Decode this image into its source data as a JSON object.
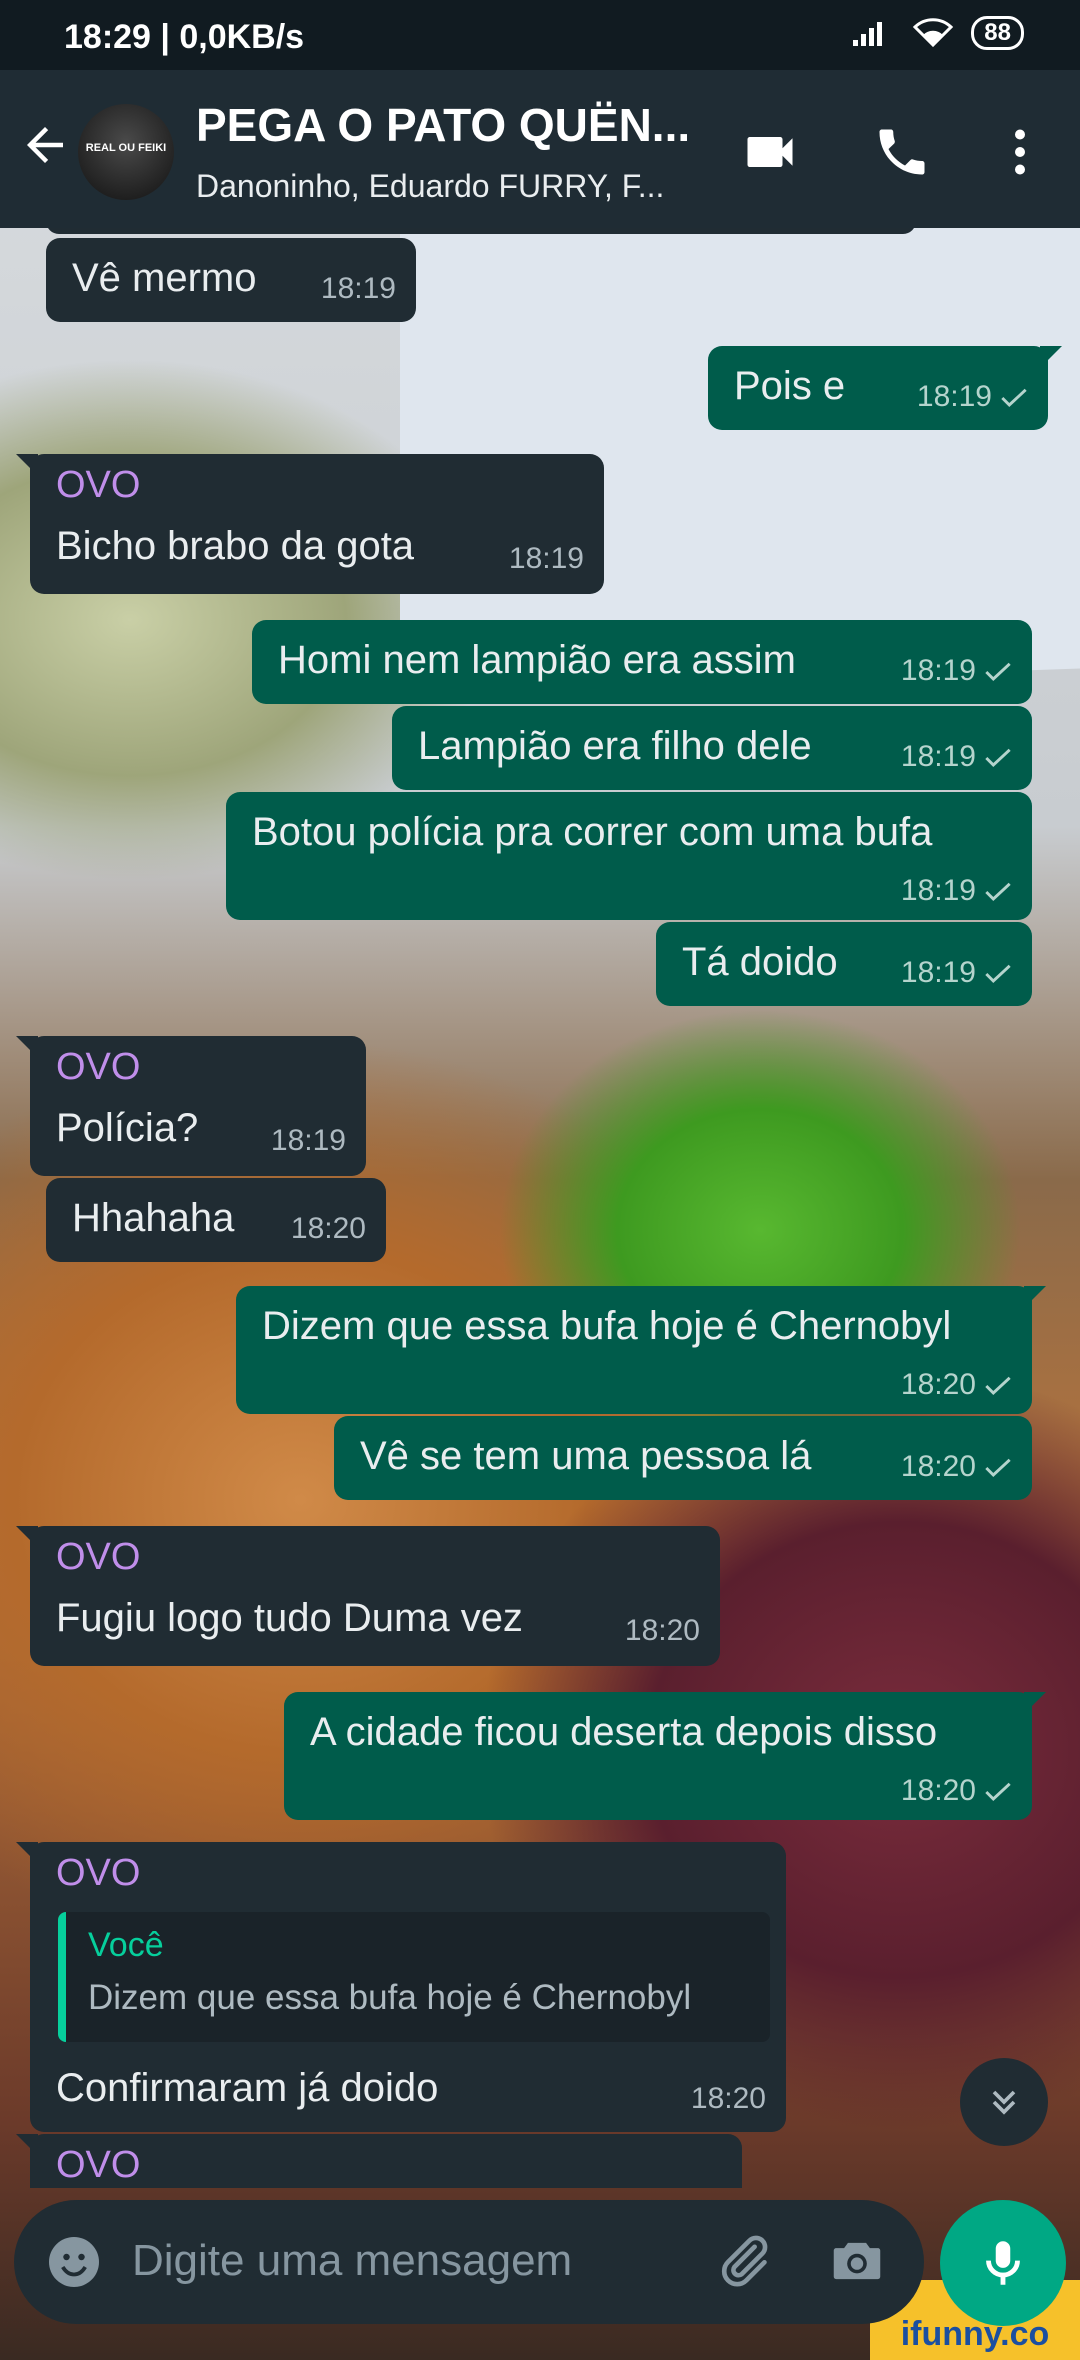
{
  "status_bar": {
    "time": "18:29 | 0,0KB/s",
    "battery": "88"
  },
  "header": {
    "back_icon": "arrow-left-icon",
    "avatar_text": "REAL OU FEIKI",
    "title": "PEGA O PATO QUËN...",
    "subtitle": "Danoninho, Eduardo FURRY, F...",
    "icons": [
      "video-call-icon",
      "phone-icon",
      "more-vert-icon"
    ]
  },
  "messages": [
    {
      "dir": "in",
      "text": "Vê mermo",
      "time": "18:19"
    },
    {
      "dir": "out",
      "text": "Pois e",
      "time": "18:19"
    },
    {
      "dir": "in",
      "sender": "OVO",
      "text": "Bicho brabo da gota",
      "time": "18:19"
    },
    {
      "dir": "out",
      "text": "Homi nem lampião era assim",
      "time": "18:19"
    },
    {
      "dir": "out",
      "text": "Lampião era filho dele",
      "time": "18:19"
    },
    {
      "dir": "out",
      "text": "Botou polícia pra correr com uma bufa",
      "time": "18:19"
    },
    {
      "dir": "out",
      "text": "Tá doido",
      "time": "18:19"
    },
    {
      "dir": "in",
      "sender": "OVO",
      "text": "Polícia?",
      "time": "18:19"
    },
    {
      "dir": "in",
      "text": "Hhahaha",
      "time": "18:20"
    },
    {
      "dir": "out",
      "text": "Dizem que essa bufa hoje é Chernobyl",
      "time": "18:20"
    },
    {
      "dir": "out",
      "text": "Vê se tem uma pessoa lá",
      "time": "18:20"
    },
    {
      "dir": "in",
      "sender": "OVO",
      "text": "Fugiu logo tudo Duma vez",
      "time": "18:20"
    },
    {
      "dir": "out",
      "text": "A cidade ficou deserta depois disso",
      "time": "18:20"
    },
    {
      "dir": "in",
      "sender": "OVO",
      "quote_author": "Você",
      "quote_text": "Dizem que essa bufa hoje é Chernobyl",
      "text": "Confirmaram já doido",
      "time": "18:20"
    },
    {
      "dir": "in",
      "sender": "OVO"
    }
  ],
  "composer": {
    "placeholder": "Digite uma mensagem",
    "icons": [
      "emoji-icon",
      "attach-icon",
      "camera-icon",
      "mic-icon"
    ]
  },
  "scroll_button_icon": "double-chevron-down-icon",
  "watermark": "ifunny.co",
  "colors": {
    "incoming": "#202c33",
    "outgoing": "#005c4b",
    "sender": "#c08eea",
    "accent": "#00a884",
    "header": "#1f2c34"
  }
}
